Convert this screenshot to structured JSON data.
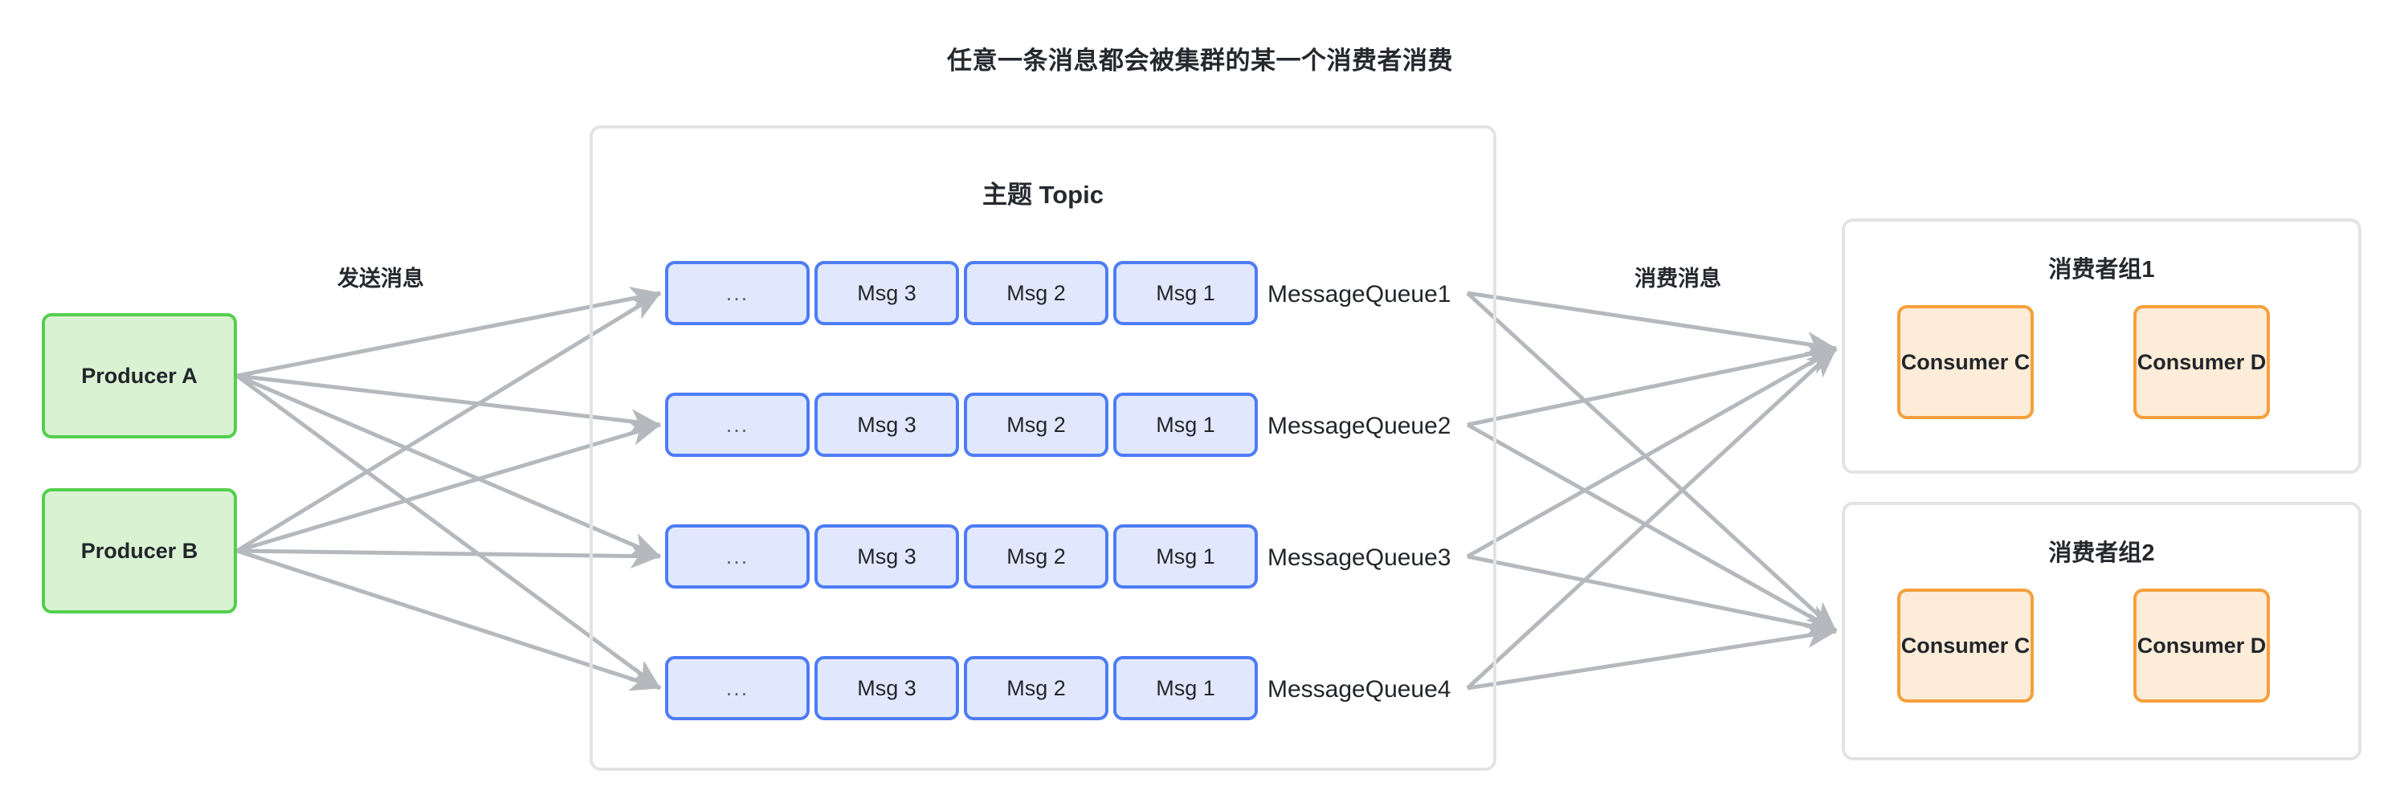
{
  "title": "任意一条消息都会被集群的某一个消费者消费",
  "flow_labels": {
    "send": "发送消息",
    "consume": "消费消息"
  },
  "producers": [
    {
      "label": "Producer A"
    },
    {
      "label": "Producer B"
    }
  ],
  "topic": {
    "title": "主题 Topic",
    "queues": [
      {
        "name": "MessageQueue1",
        "messages": [
          "...",
          "Msg 3",
          "Msg 2",
          "Msg 1"
        ]
      },
      {
        "name": "MessageQueue2",
        "messages": [
          "...",
          "Msg 3",
          "Msg 2",
          "Msg 1"
        ]
      },
      {
        "name": "MessageQueue3",
        "messages": [
          "...",
          "Msg 3",
          "Msg 2",
          "Msg 1"
        ]
      },
      {
        "name": "MessageQueue4",
        "messages": [
          "...",
          "Msg 3",
          "Msg 2",
          "Msg 1"
        ]
      }
    ]
  },
  "consumer_groups": [
    {
      "title": "消费者组1",
      "consumers": [
        {
          "label": "Consumer C"
        },
        {
          "label": "Consumer D"
        }
      ]
    },
    {
      "title": "消费者组2",
      "consumers": [
        {
          "label": "Consumer C"
        },
        {
          "label": "Consumer D"
        }
      ]
    }
  ],
  "colors": {
    "producer_fill": "#d9f2d2",
    "producer_border": "#54cf4e",
    "message_fill": "#e1e8fd",
    "message_border": "#4d7cf5",
    "consumer_fill": "#fcecd8",
    "consumer_border": "#f5a03c",
    "container_border": "#e3e3e3",
    "edge": "#b5b9bd",
    "text": "#22262b"
  }
}
